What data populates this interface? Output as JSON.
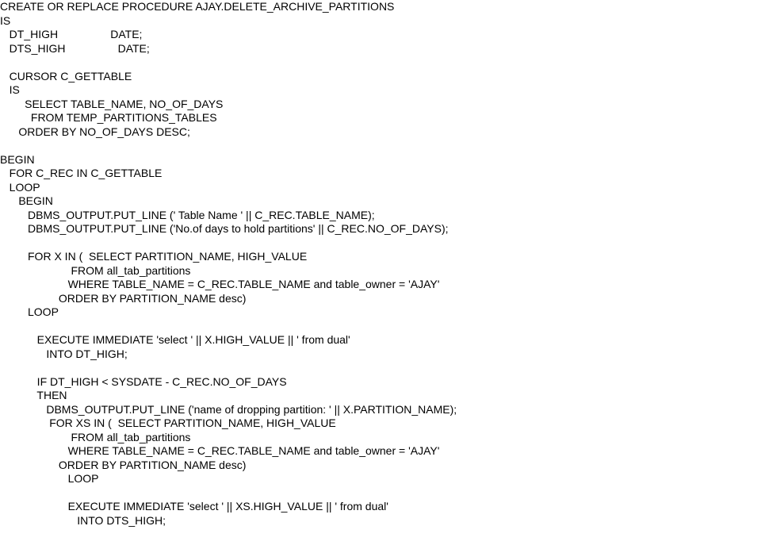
{
  "code_lines": [
    "CREATE OR REPLACE PROCEDURE AJAY.DELETE_ARCHIVE_PARTITIONS",
    "IS",
    "   DT_HIGH                 DATE;",
    "   DTS_HIGH                 DATE;",
    "",
    "   CURSOR C_GETTABLE",
    "   IS",
    "        SELECT TABLE_NAME, NO_OF_DAYS",
    "          FROM TEMP_PARTITIONS_TABLES",
    "      ORDER BY NO_OF_DAYS DESC;",
    "",
    "BEGIN",
    "   FOR C_REC IN C_GETTABLE",
    "   LOOP",
    "      BEGIN",
    "         DBMS_OUTPUT.PUT_LINE (' Table Name ' || C_REC.TABLE_NAME);",
    "         DBMS_OUTPUT.PUT_LINE ('No.of days to hold partitions' || C_REC.NO_OF_DAYS);",
    "",
    "         FOR X IN (  SELECT PARTITION_NAME, HIGH_VALUE",
    "                       FROM all_tab_partitions",
    "                      WHERE TABLE_NAME = C_REC.TABLE_NAME and table_owner = 'AJAY'",
    "                   ORDER BY PARTITION_NAME desc)",
    "         LOOP",
    "",
    "            EXECUTE IMMEDIATE 'select ' || X.HIGH_VALUE || ' from dual'",
    "               INTO DT_HIGH;",
    "",
    "            IF DT_HIGH < SYSDATE - C_REC.NO_OF_DAYS",
    "            THEN",
    "               DBMS_OUTPUT.PUT_LINE ('name of dropping partition: ' || X.PARTITION_NAME);",
    "                FOR XS IN (  SELECT PARTITION_NAME, HIGH_VALUE",
    "                       FROM all_tab_partitions",
    "                      WHERE TABLE_NAME = C_REC.TABLE_NAME and table_owner = 'AJAY'",
    "                   ORDER BY PARTITION_NAME desc)",
    "                      LOOP",
    "",
    "                      EXECUTE IMMEDIATE 'select ' || XS.HIGH_VALUE || ' from dual'",
    "                         INTO DTS_HIGH;"
  ]
}
